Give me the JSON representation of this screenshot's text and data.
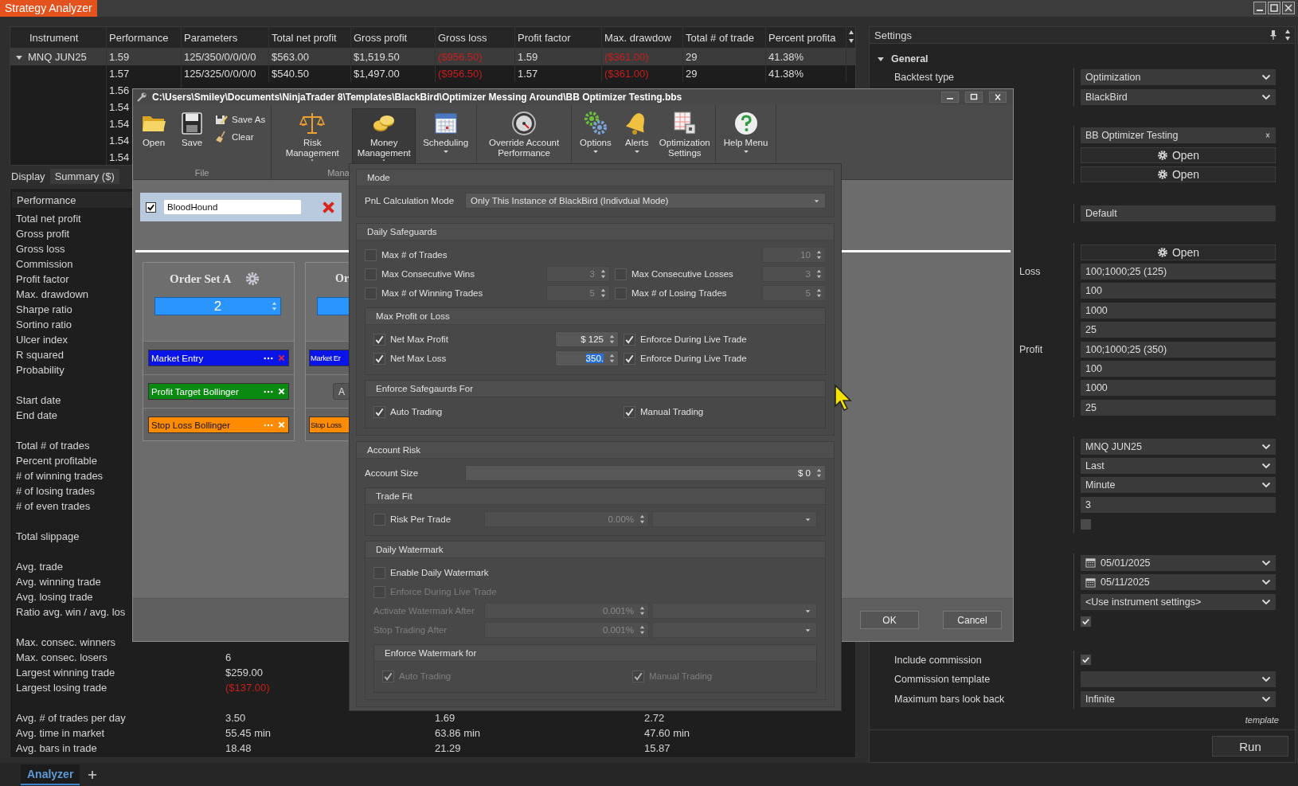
{
  "app": {
    "title": "Strategy Analyzer"
  },
  "results": {
    "columns": [
      "Instrument",
      "Performance",
      "Parameters",
      "Total net profit",
      "Gross profit",
      "Gross loss",
      "Profit factor",
      "Max. drawdow",
      "Total # of trade",
      "Percent profita"
    ],
    "groups": [
      {
        "instrument": "MNQ JUN25",
        "expanded": true,
        "rows": [
          {
            "cells": [
              {
                "text": "1.59",
                "negative": false
              },
              {
                "text": "125/350/0/0/0/0",
                "negative": false
              },
              {
                "text": "$563.00",
                "negative": false
              },
              {
                "text": "$1,519.50",
                "negative": false
              },
              {
                "text": "($956.50)",
                "negative": true
              },
              {
                "text": "1.59",
                "negative": false
              },
              {
                "text": "($361.00)",
                "negative": true
              },
              {
                "text": "29",
                "negative": false
              },
              {
                "text": "41.38%",
                "negative": false
              }
            ]
          },
          {
            "cells": [
              {
                "text": "1.57",
                "negative": false
              },
              {
                "text": "125/325/0/0/0/0",
                "negative": false
              },
              {
                "text": "$540.50",
                "negative": false
              },
              {
                "text": "$1,497.00",
                "negative": false
              },
              {
                "text": "($956.50)",
                "negative": true
              },
              {
                "text": "1.57",
                "negative": false
              },
              {
                "text": "($361.00)",
                "negative": true
              },
              {
                "text": "29",
                "negative": false
              },
              {
                "text": "41.38%",
                "negative": false
              }
            ]
          },
          {
            "cells": [
              {
                "text": "1.56",
                "negative": false
              }
            ]
          },
          {
            "cells": [
              {
                "text": "1.54",
                "negative": false
              }
            ]
          },
          {
            "cells": [
              {
                "text": "1.54",
                "negative": false
              }
            ]
          },
          {
            "cells": [
              {
                "text": "1.54",
                "negative": false
              }
            ]
          },
          {
            "cells": [
              {
                "text": "1.54",
                "negative": false
              }
            ]
          }
        ]
      }
    ]
  },
  "display": {
    "label": "Display",
    "value": "Summary ($)"
  },
  "performance": {
    "header": "Performance",
    "sections": [
      {
        "rows": [
          {
            "label": "Total net profit"
          },
          {
            "label": "Gross profit"
          },
          {
            "label": "Gross loss"
          },
          {
            "label": "Commission"
          },
          {
            "label": "Profit factor"
          },
          {
            "label": "Max. drawdown"
          },
          {
            "label": "Sharpe ratio"
          },
          {
            "label": "Sortino ratio"
          },
          {
            "label": "Ulcer index"
          },
          {
            "label": "R squared"
          },
          {
            "label": "Probability"
          }
        ]
      },
      {
        "rows": [
          {
            "label": "Start date"
          },
          {
            "label": "End date"
          }
        ]
      },
      {
        "rows": [
          {
            "label": "Total # of trades"
          },
          {
            "label": "Percent profitable"
          },
          {
            "label": "# of winning trades"
          },
          {
            "label": "# of losing trades"
          },
          {
            "label": "# of even trades"
          }
        ]
      },
      {
        "rows": [
          {
            "label": "Total slippage"
          }
        ]
      },
      {
        "rows": [
          {
            "label": "Avg. trade"
          },
          {
            "label": "Avg. winning trade"
          },
          {
            "label": "Avg. losing trade"
          },
          {
            "label": "Ratio avg. win / avg. los"
          }
        ]
      },
      {
        "rows": [
          {
            "label": "Max. consec. winners"
          },
          {
            "label": "Max. consec. losers",
            "values": [
              {
                "text": "6",
                "negative": false
              }
            ]
          },
          {
            "label": "Largest winning trade",
            "values": [
              {
                "text": "$259.00",
                "negative": false
              }
            ]
          },
          {
            "label": "Largest losing trade",
            "values": [
              {
                "text": "($137.00)",
                "negative": true
              }
            ]
          }
        ]
      },
      {
        "rows": [
          {
            "label": "Avg. # of trades per day",
            "values": [
              {
                "text": "3.50",
                "negative": false
              },
              {
                "text": "1.69",
                "negative": false
              },
              {
                "text": "2.72",
                "negative": false
              }
            ]
          },
          {
            "label": "Avg. time in market",
            "values": [
              {
                "text": "55.45 min",
                "negative": false
              },
              {
                "text": "63.86 min",
                "negative": false
              },
              {
                "text": "47.60 min",
                "negative": false
              }
            ]
          },
          {
            "label": "Avg. bars in trade",
            "values": [
              {
                "text": "18.48",
                "negative": false
              },
              {
                "text": "21.29",
                "negative": false
              },
              {
                "text": "15.87",
                "negative": false
              }
            ]
          }
        ]
      }
    ]
  },
  "settings": {
    "title": "Settings",
    "category": {
      "label": "General",
      "expanded": true
    },
    "groups": [
      [
        {
          "kind": "dropdown",
          "label": "Backtest type",
          "value": "Optimization"
        },
        {
          "kind": "dropdown",
          "value": "BlackBird"
        }
      ],
      [
        {
          "kind": "text-clear",
          "value": "BB Optimizer Testing"
        },
        {
          "kind": "button",
          "value": "Open"
        },
        {
          "kind": "button",
          "value": "Open"
        }
      ],
      [
        {
          "kind": "text",
          "value": "Default"
        }
      ],
      [
        {
          "kind": "button",
          "value": "Open"
        },
        {
          "kind": "text",
          "partial_label": "Loss",
          "value": "100;1000;25 (125)"
        },
        {
          "kind": "text",
          "value": "100"
        },
        {
          "kind": "text",
          "value": "1000"
        },
        {
          "kind": "text",
          "value": "25"
        },
        {
          "kind": "text",
          "partial_label": "Profit",
          "value": "100;1000;25 (350)"
        },
        {
          "kind": "text",
          "value": "100"
        },
        {
          "kind": "text",
          "value": "1000"
        },
        {
          "kind": "text",
          "value": "25"
        }
      ],
      [
        {
          "kind": "dropdown",
          "value": "MNQ JUN25"
        },
        {
          "kind": "dropdown",
          "value": "Last"
        },
        {
          "kind": "dropdown",
          "value": "Minute"
        },
        {
          "kind": "text",
          "value": "3"
        },
        {
          "kind": "checkbox",
          "checked": false
        }
      ],
      [
        {
          "kind": "date",
          "value": "05/01/2025"
        },
        {
          "kind": "date",
          "value": "05/11/2025"
        },
        {
          "kind": "dropdown",
          "value": "<Use instrument settings>"
        },
        {
          "kind": "checkbox",
          "checked": true
        }
      ],
      [
        {
          "kind": "checkbox",
          "label": "Include commission",
          "checked": true
        },
        {
          "kind": "dropdown",
          "label": "Commission template"
        },
        {
          "kind": "dropdown",
          "label": "Maximum bars look back",
          "value": "Infinite"
        }
      ]
    ],
    "note": "template",
    "run": "Run"
  },
  "bottom_tabs": [
    {
      "label": "Analyzer",
      "selected": true
    }
  ],
  "dialog": {
    "title": "C:\\Users\\Smiley\\Documents\\NinjaTrader 8\\Templates\\BlackBird\\Optimizer Messing Around\\BB Optimizer Testing.bbs",
    "ribbon": [
      {
        "label": "File",
        "buttons": [
          {
            "kind": "open",
            "label": "Open",
            "selected": false,
            "caret": false
          },
          {
            "kind": "save",
            "label": "Save",
            "selected": false,
            "caret": false
          },
          {
            "kind": "save-as",
            "label": "Save As",
            "selected": false
          },
          {
            "kind": "clear",
            "label": "Clear",
            "selected": false
          }
        ]
      },
      {
        "label": "Mana",
        "buttons": [
          {
            "kind": "risk",
            "label": "Risk Management",
            "selected": false,
            "caret": true
          },
          {
            "kind": "money",
            "label": "Money Management",
            "selected": true,
            "caret": true
          },
          {
            "kind": "schedule",
            "label": "Scheduling",
            "selected": false,
            "caret": true
          }
        ]
      },
      {
        "buttons": [
          {
            "kind": "override",
            "label": "Override Account Performance",
            "selected": false,
            "caret": false
          }
        ]
      },
      {
        "buttons": [
          {
            "kind": "options",
            "label": "Options",
            "selected": false,
            "caret": true
          },
          {
            "kind": "alerts",
            "label": "Alerts",
            "selected": false,
            "caret": true
          },
          {
            "kind": "optimization",
            "label": "Optimization Settings",
            "selected": false,
            "caret": false
          }
        ]
      },
      {
        "buttons": [
          {
            "kind": "help",
            "label": "Help Menu",
            "selected": false,
            "caret": true
          }
        ]
      }
    ],
    "strategy": {
      "enabled": true,
      "name": "BloodHound"
    },
    "order_sets": [
      {
        "title": "Order Set A",
        "count": "2",
        "slots": [
          {
            "kind": "order",
            "label": "Market Entry",
            "color": "#0a14e6",
            "close": {
              "color": "#e0283c"
            }
          },
          {
            "kind": "order",
            "label": "Profit Target Bollinger",
            "color": "#0b8a12",
            "close": {
              "color": "#ffffff"
            }
          },
          {
            "kind": "order",
            "label": "Stop Loss Bollinger",
            "color": "#ff8c00",
            "close": {
              "color": "#ffffff"
            }
          }
        ]
      },
      {
        "title": "Or",
        "slots": [
          {
            "kind": "order",
            "label": "Market Er",
            "color": "#0a14e6"
          },
          {
            "kind": "button",
            "label": "A"
          },
          {
            "kind": "order",
            "label": "Stop Loss",
            "color": "#ff8c00"
          }
        ]
      }
    ],
    "buttons": [
      "OK",
      "Cancel"
    ]
  },
  "money_panel": {
    "groups": [
      {
        "title": "Mode",
        "rows": [
          {
            "kind": "select",
            "label": "PnL Calculation Mode",
            "value": "Only This Instance of BlackBird (Indivdual Mode)"
          }
        ]
      },
      {
        "title": "Daily Safeguards",
        "rows": [
          {
            "kind": "pairs",
            "left": {
              "label": "Max # of Trades",
              "checked": false,
              "disabled": false
            },
            "right": {
              "value": "10",
              "disabled": true
            }
          },
          {
            "kind": "pairs",
            "left": {
              "label": "Max Consecutive Wins",
              "checked": false,
              "disabled": false,
              "value": "3"
            },
            "right": {
              "label": "Max Consecutive Losses",
              "checked": false,
              "disabled": false,
              "value": "3"
            }
          },
          {
            "kind": "pairs",
            "left": {
              "label": "Max # of Winning Trades",
              "checked": false,
              "disabled": false,
              "value": "5"
            },
            "right": {
              "label": "Max # of Losing Trades",
              "checked": false,
              "disabled": false,
              "value": "5"
            }
          }
        ],
        "groups": [
          {
            "title": "Max Profit or Loss",
            "rows": [
              {
                "kind": "pairs",
                "left": {
                  "label": "Net Max Profit",
                  "checked": true,
                  "disabled": false,
                  "value": "$ 125",
                  "selected": false
                },
                "right": {
                  "label": "Enforce During Live Trade",
                  "checked": true,
                  "disabled": false
                }
              },
              {
                "kind": "pairs",
                "left": {
                  "label": "Net Max Loss",
                  "checked": true,
                  "disabled": false,
                  "value": "350.",
                  "selected": true
                },
                "right": {
                  "label": "Enforce During Live Trade",
                  "checked": true,
                  "disabled": false
                }
              }
            ]
          },
          {
            "title": "Enforce Safegaurds For",
            "rows": [
              {
                "kind": "pairs",
                "left": {
                  "label": "Auto Trading",
                  "checked": true,
                  "disabled": false
                },
                "right": {
                  "label": "Manual Trading",
                  "checked": true,
                  "disabled": false
                }
              }
            ]
          }
        ]
      },
      {
        "title": "Account Risk",
        "rows": [
          {
            "kind": "spin",
            "label": "Account Size",
            "value": "$ 0"
          }
        ],
        "groups": [
          {
            "title": "Trade Fit",
            "rows": [
              {
                "kind": "spin-select",
                "label": "Risk Per Trade",
                "checked": false,
                "disabled": false,
                "value": "0.00%"
              }
            ]
          },
          {
            "title": "Daily Watermark",
            "rows": [
              {
                "kind": "pairs",
                "left": {
                  "label": "Enable Daily Watermark",
                  "checked": false,
                  "disabled": false
                }
              },
              {
                "kind": "pairs",
                "left": {
                  "label": "Enforce During Live Trade",
                  "checked": false,
                  "disabled": true
                }
              },
              {
                "kind": "spin-select",
                "label": "Activate Watermark After",
                "disabled": true,
                "value": "0.001%"
              },
              {
                "kind": "spin-select",
                "label": "Stop Trading After",
                "disabled": true,
                "value": "0.001%"
              }
            ],
            "groups": [
              {
                "title": "Enforce Watermark for",
                "rows": [
                  {
                    "kind": "pairs",
                    "left": {
                      "label": "Auto Trading",
                      "checked": true,
                      "disabled": true
                    },
                    "right": {
                      "label": "Manual Trading",
                      "checked": true,
                      "disabled": true
                    }
                  }
                ]
              }
            ]
          }
        ]
      }
    ]
  }
}
